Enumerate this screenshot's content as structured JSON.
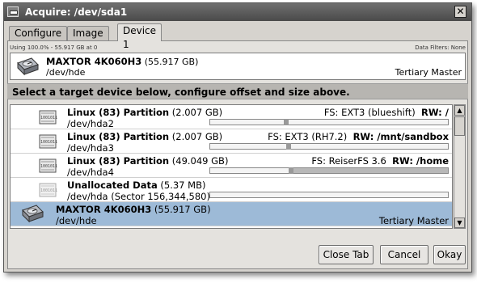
{
  "window": {
    "title": "Acquire: /dev/sda1"
  },
  "tabs": [
    {
      "label": "Configure"
    },
    {
      "label": "Image 1"
    },
    {
      "label": "Device 1"
    }
  ],
  "status": {
    "usage": "Using 100.0% - 55.917 GB at 0",
    "filters": "Data Filters: None"
  },
  "selected_device": {
    "name": "MAXTOR 4K060H3",
    "size": "(55.917 GB)",
    "path": "/dev/hde",
    "role": "Tertiary Master"
  },
  "instructions": "Select a target device below, configure offset and size above.",
  "devices": [
    {
      "name": "Linux (83) Partition",
      "size": "(2.007 GB)",
      "path": "/dev/hda2",
      "fs": "FS: EXT3 (blueshift)",
      "mount": "RW: /",
      "fill": 0.31
    },
    {
      "name": "Linux (83) Partition",
      "size": "(2.007 GB)",
      "path": "/dev/hda3",
      "fs": "FS: EXT3 (RH7.2)",
      "mount": "RW: /mnt/sandbox",
      "fill": 0.32
    },
    {
      "name": "Linux (83) Partition",
      "size": "(49.049 GB)",
      "path": "/dev/hda4",
      "fs": "FS: ReiserFS 3.6",
      "mount": "RW: /home",
      "fill": 0.33
    },
    {
      "name": "Unallocated Data",
      "size": "(5.37 MB)",
      "path": "/dev/hda (Sector 156,344,580)",
      "fs": "",
      "mount": "",
      "fill": 0
    },
    {
      "name": "MAXTOR 4K060H3",
      "size": "(55.917 GB)",
      "path": "/dev/hde",
      "fs": "",
      "mount": "",
      "role": "Tertiary Master"
    }
  ],
  "chip_icon_text": "1001011",
  "buttons": {
    "close_tab": "Close Tab",
    "cancel": "Cancel",
    "okay": "Okay"
  },
  "icons": {
    "window_menu": "window-menu-icon",
    "close": "close-icon",
    "disk": "hard-disk-icon",
    "partition": "chip-icon",
    "scroll_up": "arrow-up-icon",
    "scroll_down": "arrow-down-icon"
  }
}
